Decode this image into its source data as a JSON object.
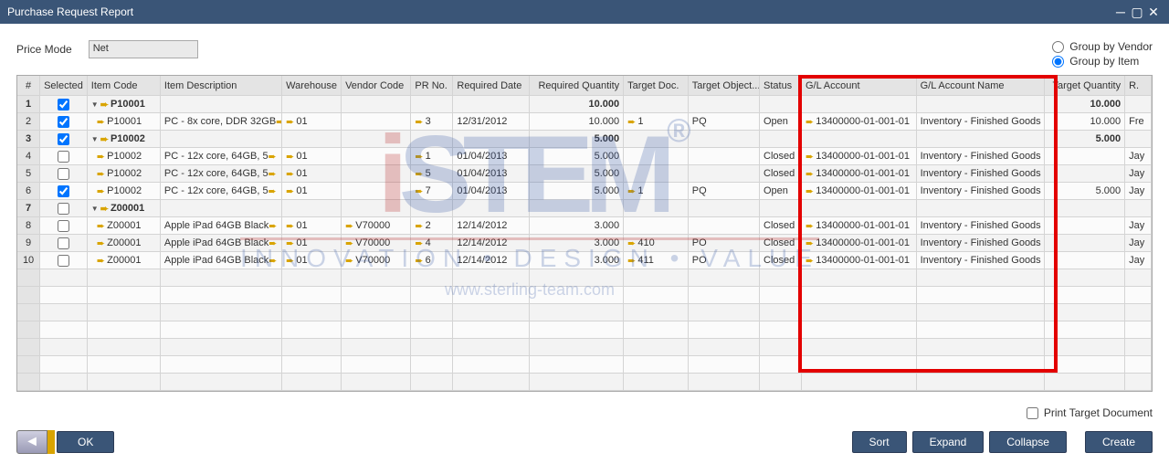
{
  "window": {
    "title": "Purchase Request Report"
  },
  "price_mode": {
    "label": "Price Mode",
    "value": "Net"
  },
  "group_opts": {
    "vendor": "Group by Vendor",
    "item": "Group by Item",
    "selected": "item"
  },
  "columns": {
    "rownum": "#",
    "sel": "Selected",
    "code": "Item Code",
    "desc": "Item Description",
    "wh": "Warehouse",
    "vcode": "Vendor Code",
    "pr": "PR No.",
    "rdate": "Required Date",
    "rqty": "Required Quantity",
    "tdoc": "Target Doc.",
    "tobj": "Target Object...",
    "stat": "Status",
    "gl": "G/L Account",
    "gln": "G/L Account Name",
    "tqty": "Target Quantity",
    "r": "R."
  },
  "rows": [
    {
      "n": "1",
      "sel": true,
      "group": true,
      "code": "P10001",
      "rqty": "10.000",
      "tqty": "10.000"
    },
    {
      "n": "2",
      "sel": true,
      "code": "P10001",
      "desc": "PC - 8x core, DDR 32GB",
      "wh": "01",
      "pr": "3",
      "rdate": "12/31/2012",
      "rqty": "10.000",
      "tdoc": "1",
      "tobj": "PQ",
      "stat": "Open",
      "gl": "13400000-01-001-01",
      "gln": "Inventory - Finished Goods",
      "tqty": "10.000",
      "r": "Fre"
    },
    {
      "n": "3",
      "sel": true,
      "group": true,
      "code": "P10002",
      "rqty": "5.000",
      "tqty": "5.000"
    },
    {
      "n": "4",
      "sel": false,
      "code": "P10002",
      "desc": "PC - 12x core, 64GB, 5",
      "wh": "01",
      "pr": "1",
      "rdate": "01/04/2013",
      "rqty": "5.000",
      "stat": "Closed",
      "gl": "13400000-01-001-01",
      "gln": "Inventory - Finished Goods",
      "r": "Jay"
    },
    {
      "n": "5",
      "sel": false,
      "code": "P10002",
      "desc": "PC - 12x core, 64GB, 5",
      "wh": "01",
      "pr": "5",
      "rdate": "01/04/2013",
      "rqty": "5.000",
      "stat": "Closed",
      "gl": "13400000-01-001-01",
      "gln": "Inventory - Finished Goods",
      "r": "Jay"
    },
    {
      "n": "6",
      "sel": true,
      "code": "P10002",
      "desc": "PC - 12x core, 64GB, 5",
      "wh": "01",
      "pr": "7",
      "rdate": "01/04/2013",
      "rqty": "5.000",
      "tdoc": "1",
      "tobj": "PQ",
      "stat": "Open",
      "gl": "13400000-01-001-01",
      "gln": "Inventory - Finished Goods",
      "tqty": "5.000",
      "r": "Jay"
    },
    {
      "n": "7",
      "sel": false,
      "group": true,
      "code": "Z00001"
    },
    {
      "n": "8",
      "sel": false,
      "code": "Z00001",
      "desc": "Apple iPad 64GB Black",
      "wh": "01",
      "vcode": "V70000",
      "pr": "2",
      "rdate": "12/14/2012",
      "rqty": "3.000",
      "stat": "Closed",
      "gl": "13400000-01-001-01",
      "gln": "Inventory - Finished Goods",
      "r": "Jay"
    },
    {
      "n": "9",
      "sel": false,
      "code": "Z00001",
      "desc": "Apple iPad 64GB Black",
      "wh": "01",
      "vcode": "V70000",
      "pr": "4",
      "rdate": "12/14/2012",
      "rqty": "3.000",
      "tdoc": "410",
      "tobj": "PO",
      "stat": "Closed",
      "gl": "13400000-01-001-01",
      "gln": "Inventory - Finished Goods",
      "r": "Jay"
    },
    {
      "n": "10",
      "sel": false,
      "code": "Z00001",
      "desc": "Apple iPad 64GB Black",
      "wh": "01",
      "vcode": "V70000",
      "pr": "6",
      "rdate": "12/14/2012",
      "rqty": "3.000",
      "tdoc": "411",
      "tobj": "PO",
      "stat": "Closed",
      "gl": "13400000-01-001-01",
      "gln": "Inventory - Finished Goods",
      "r": "Jay"
    }
  ],
  "print_target": "Print Target Document",
  "buttons": {
    "ok": "OK",
    "sort": "Sort",
    "expand": "Expand",
    "collapse": "Collapse",
    "create": "Create"
  },
  "watermark": {
    "brand": "iSTEM",
    "tag": "INNOVATION • DESIGN • VALUE",
    "url": "www.sterling-team.com"
  }
}
